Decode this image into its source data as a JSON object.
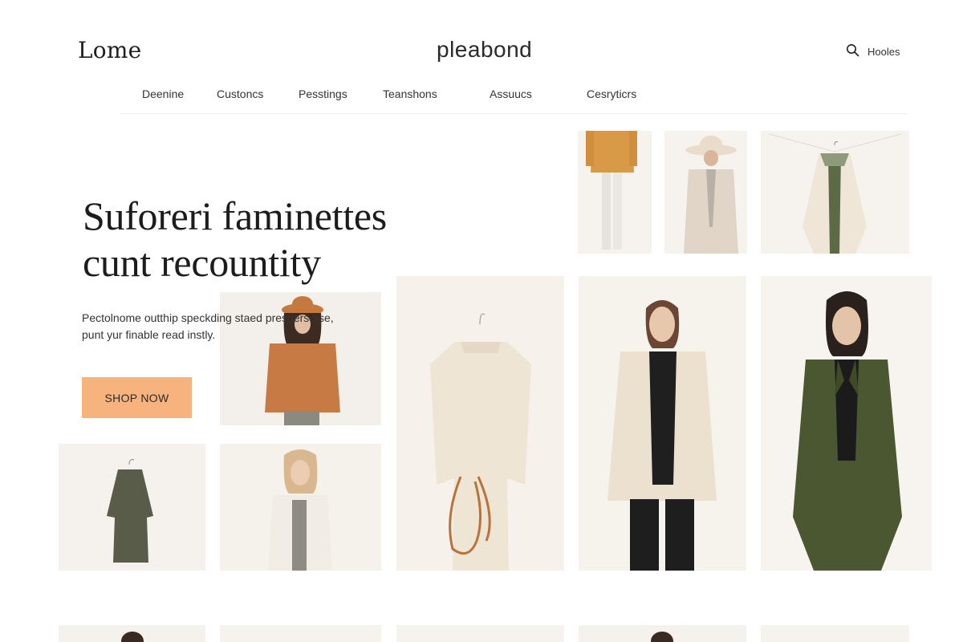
{
  "header": {
    "logo_left": "Lome",
    "logo_center": "pleabond",
    "search_label": "Hooles"
  },
  "nav": {
    "items": [
      {
        "label": "Deenine"
      },
      {
        "label": "Custoncs"
      },
      {
        "label": "Pesstings"
      },
      {
        "label": "Teanshons"
      },
      {
        "label": "Assuucs"
      },
      {
        "label": "Cesryticrs"
      }
    ]
  },
  "hero": {
    "title_line1": "Suforeri faminettes",
    "title_line2": "cunt recountity",
    "subtitle_line1": "Pectolnome outthip speckding staed presgers ase,",
    "subtitle_line2": "punt yur finable read instly.",
    "cta_label": "SHOP NOW"
  },
  "colors": {
    "cta": "#f6b37e",
    "card_bg": "#f5f1ec",
    "mustard": "#d99a47",
    "rust": "#c77a43",
    "cream": "#efe6d8",
    "olive": "#4b5730",
    "black": "#1e1e1e"
  },
  "icons": {
    "search": "search-icon"
  }
}
